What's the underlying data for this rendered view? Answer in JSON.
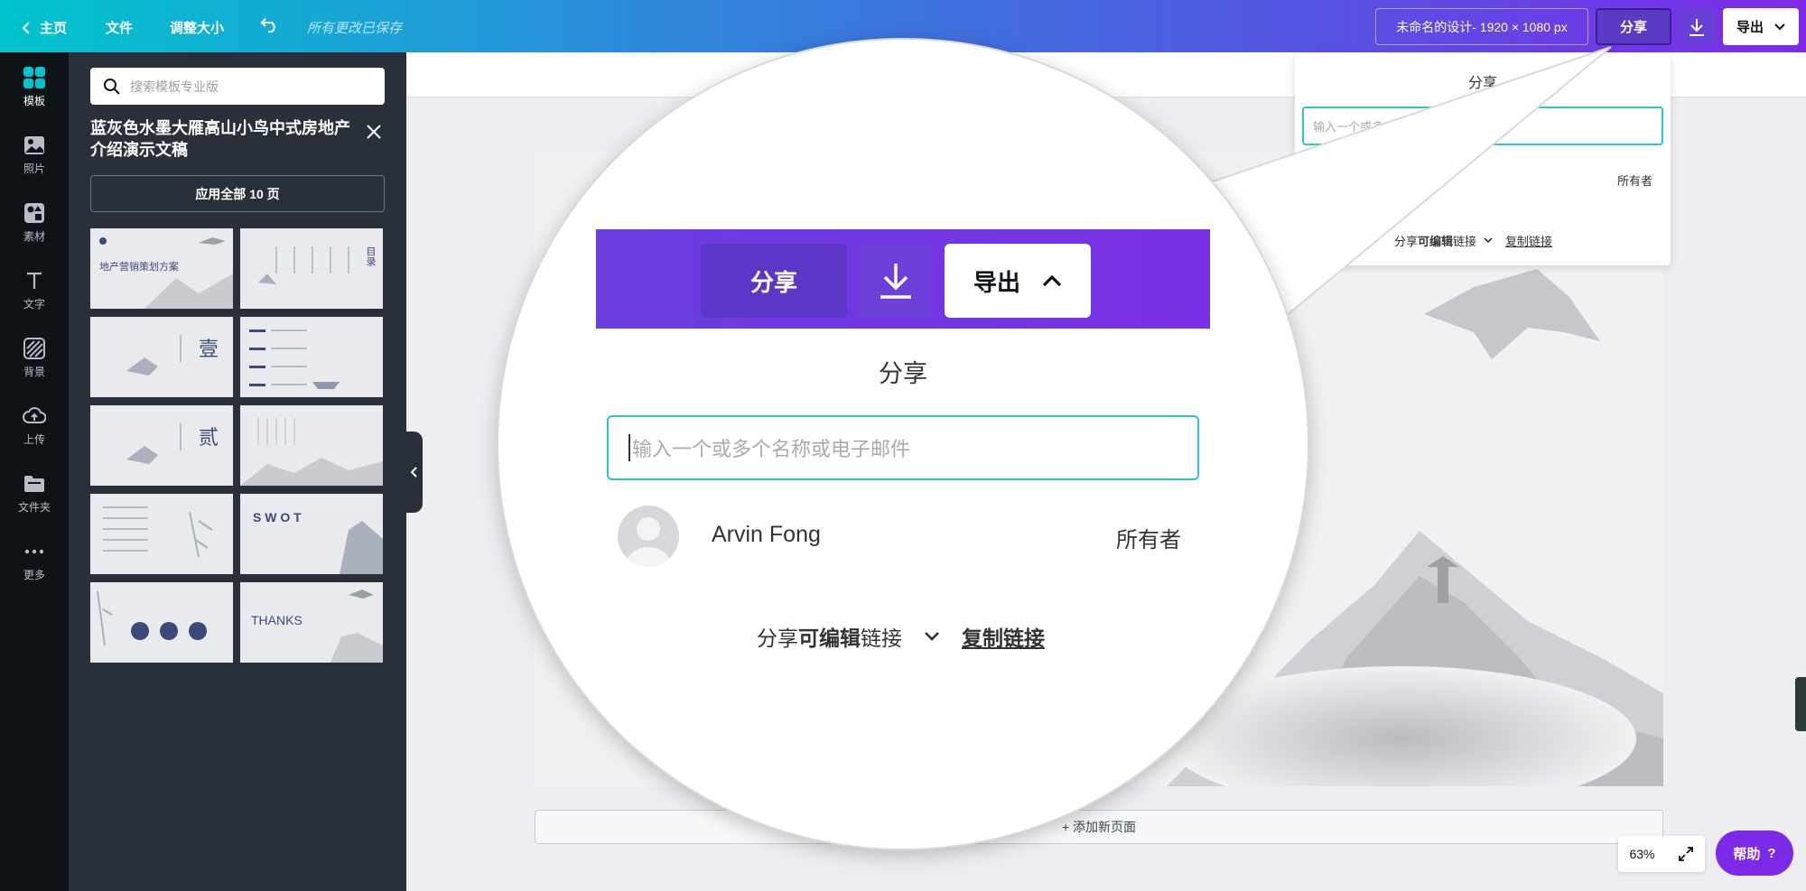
{
  "topbar": {
    "home": "主页",
    "file": "文件",
    "resize": "调整大小",
    "saved_status": "所有更改已保存",
    "design_title": "未命名的设计- 1920 × 1080 px",
    "share": "分享",
    "export": "导出"
  },
  "rail": [
    {
      "label": "模板",
      "icon": "template-icon"
    },
    {
      "label": "照片",
      "icon": "photo-icon"
    },
    {
      "label": "素材",
      "icon": "elements-icon"
    },
    {
      "label": "文字",
      "icon": "text-icon"
    },
    {
      "label": "背景",
      "icon": "background-icon"
    },
    {
      "label": "上传",
      "icon": "upload-icon"
    },
    {
      "label": "文件夹",
      "icon": "folder-icon"
    },
    {
      "label": "更多",
      "icon": "more-icon"
    }
  ],
  "panel": {
    "search_placeholder": "搜索模板专业版",
    "template_title": "蓝灰色水墨大雁高山小鸟中式房地产介绍演示文稿",
    "apply_all": "应用全部 10 页",
    "thumb_texts": {
      "t1": "地产营销策划方案",
      "t2": "目录",
      "t3": "壹",
      "t5": "贰",
      "t8": "S W O T",
      "t10": "THANKS"
    }
  },
  "canvas": {
    "add_page": "+ 添加新页面"
  },
  "share_popover": {
    "title": "分享",
    "input_placeholder": "输入一个或多个名称或电子邮件",
    "user_name": "Arvin Fong",
    "owner_role": "所有者",
    "link_prefix": "分享",
    "link_bold": "可编辑",
    "link_suffix": "链接",
    "copy_link": "复制链接"
  },
  "bottom": {
    "zoom": "63%",
    "help": "帮助",
    "help_mark": "?"
  },
  "colors": {
    "accent_purple": "#7d2ae8",
    "accent_teal": "#00c4cc",
    "panel_bg": "#293039",
    "rail_bg": "#0e1318"
  }
}
